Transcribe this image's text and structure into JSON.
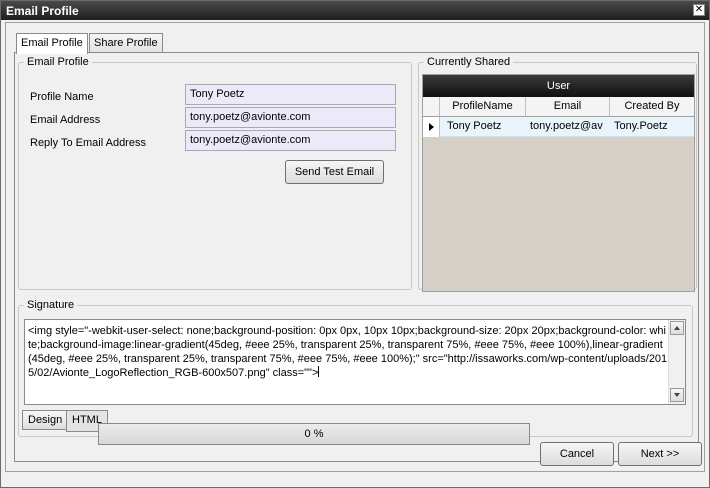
{
  "window": {
    "title": "Email Profile",
    "close_glyph": "✕"
  },
  "tabs": [
    {
      "label": "Email Profile",
      "active": true
    },
    {
      "label": "Share Profile",
      "active": false
    }
  ],
  "email_profile_group": {
    "legend": "Email Profile",
    "fields": [
      {
        "label": "Profile Name",
        "value": "Tony Poetz"
      },
      {
        "label": "Email Address",
        "value": "tony.poetz@avionte.com"
      },
      {
        "label": "Reply To Email Address",
        "value": "tony.poetz@avionte.com"
      }
    ],
    "send_test_label": "Send Test Email"
  },
  "currently_shared": {
    "legend": "Currently Shared",
    "group_header": "User",
    "columns": [
      "ProfileName",
      "Email",
      "Created By"
    ],
    "rows": [
      {
        "profile_name": "Tony Poetz",
        "email": "tony.poetz@av",
        "created_by": "Tony.Poetz"
      }
    ]
  },
  "signature": {
    "legend": "Signature",
    "html": "<img style=\"-webkit-user-select: none;background-position: 0px 0px, 10px 10px;background-size: 20px 20px;background-color: white;background-image:linear-gradient(45deg, #eee 25%, transparent 25%, transparent 75%, #eee 75%, #eee 100%),linear-gradient(45deg, #eee 25%, transparent 25%, transparent 75%, #eee 75%, #eee 100%);\" src=\"http://issaworks.com/wp-content/uploads/2015/02/Avionte_LogoReflection_RGB-600x507.png\" class=\"\">",
    "tabs": [
      {
        "label": "Design"
      },
      {
        "label": "HTML"
      }
    ]
  },
  "footer": {
    "progress_text": "0 %",
    "progress_fraction": 0,
    "cancel_label": "Cancel",
    "next_label": "Next >>"
  },
  "colors": {
    "title_bar": "#1e1e1e",
    "input_background": "#eceaf9",
    "grid_header": "#101010",
    "selected_row": "#e9f5fb"
  }
}
